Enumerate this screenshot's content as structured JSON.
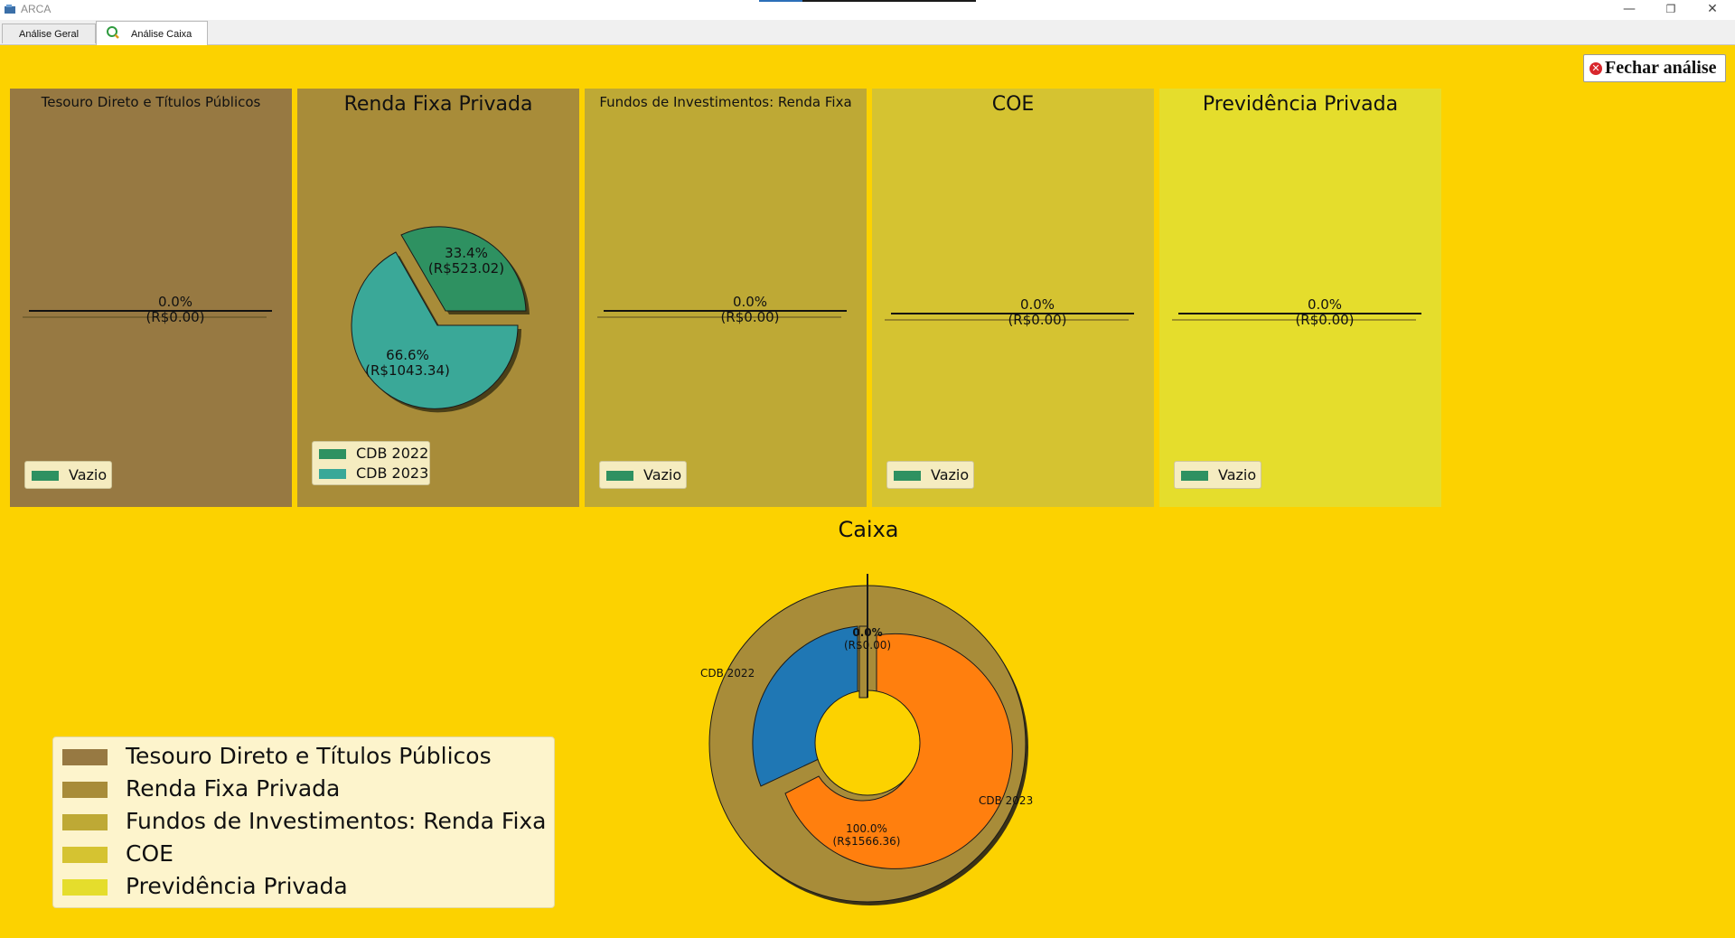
{
  "window": {
    "title": "ARCA",
    "minimize": "—",
    "restore": "❐",
    "close": "✕"
  },
  "tabs": [
    {
      "label": "Análise Geral",
      "active": false
    },
    {
      "label": "Análise Caixa",
      "active": true,
      "icon": "refresh-search-icon"
    }
  ],
  "close_analysis": {
    "label": "Fechar análise",
    "icon": "close-circle-icon"
  },
  "panels": [
    {
      "title": "Tesouro Direto e Títulos Públicos",
      "color": "#977942",
      "empty": true,
      "pct": "0.0%",
      "amount": "(R$0.00)",
      "legend": [
        "Vazio"
      ]
    },
    {
      "title": "Renda Fixa Privada",
      "color": "#a88c39",
      "empty": false,
      "slices": [
        {
          "label": "CDB 2022",
          "pct": "33.4%",
          "amount": "(R$523.02)",
          "value": 523.02,
          "color": "#2e9161"
        },
        {
          "label": "CDB 2023",
          "pct": "66.6%",
          "amount": "(R$1043.34)",
          "value": 1043.34,
          "color": "#3aa898"
        }
      ],
      "legend": [
        "CDB 2022",
        "CDB 2023"
      ]
    },
    {
      "title": "Fundos de Investimentos: Renda Fixa",
      "color": "#bea935",
      "empty": true,
      "pct": "0.0%",
      "amount": "(R$0.00)",
      "legend": [
        "Vazio"
      ]
    },
    {
      "title": "COE",
      "color": "#d5c331",
      "empty": true,
      "pct": "0.0%",
      "amount": "(R$0.00)",
      "legend": [
        "Vazio"
      ]
    },
    {
      "title": "Previdência Privada",
      "color": "#e5dd2c",
      "empty": true,
      "pct": "0.0%",
      "amount": "(R$0.00)",
      "legend": [
        "Vazio"
      ]
    }
  ],
  "legend_swatch_color": "#2e9161",
  "caixa": {
    "title": "Caixa",
    "outer_ring": {
      "color": "#a88c39"
    },
    "inner": [
      {
        "label": "CDB 2022",
        "color": "#1f77b4"
      },
      {
        "label": "CDB 2023",
        "color": "#ff7f0e"
      }
    ],
    "zero_label": {
      "pct": "0.0%",
      "amount": "(R$0.00)"
    },
    "main_label": {
      "pct": "100.0%",
      "amount": "(R$1566.36)"
    }
  },
  "main_legend": [
    {
      "label": "Tesouro Direto e Títulos Públicos",
      "color": "#977942"
    },
    {
      "label": "Renda Fixa Privada",
      "color": "#a88c39"
    },
    {
      "label": "Fundos de Investimentos: Renda Fixa",
      "color": "#bea935"
    },
    {
      "label": "COE",
      "color": "#d5c331"
    },
    {
      "label": "Previdência Privada",
      "color": "#e5dd2c"
    }
  ]
}
